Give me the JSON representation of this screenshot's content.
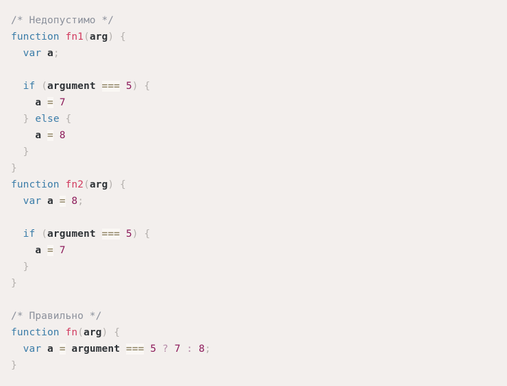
{
  "code_block": {
    "language": "javascript",
    "background_color": "#f3efed",
    "token_colors": {
      "comment": "#8b909b",
      "keyword": "#3a7ca8",
      "function_name": "#d13a5e",
      "identifier": "#2f3337",
      "number": "#8c1a5a",
      "operator": "#9a8f72",
      "operator_background": "#faf7f4",
      "ternary": "#b58aa8",
      "punctuation": "#b4b0ad"
    },
    "plain_text": "/* Недопустимо */\nfunction fn1(arg) {\n  var a;\n\n  if (argument === 5) {\n    a = 7\n  } else {\n    a = 8\n  }\n}\nfunction fn2(arg) {\n  var a = 8;\n\n  if (argument === 5) {\n    a = 7\n  }\n}\n\n/* Правильно */\nfunction fn(arg) {\n  var a = argument === 5 ? 7 : 8;\n}",
    "lines": [
      {
        "id": "line-1",
        "tokens": [
          {
            "t": "/* Недопустимо */",
            "c": "comment"
          }
        ]
      },
      {
        "id": "line-2",
        "tokens": [
          {
            "t": "function",
            "c": "keyword"
          },
          {
            "t": " ",
            "c": "plain"
          },
          {
            "t": "fn1",
            "c": "fnname"
          },
          {
            "t": "(",
            "c": "punct"
          },
          {
            "t": "arg",
            "c": "ident"
          },
          {
            "t": ")",
            "c": "punct"
          },
          {
            "t": " ",
            "c": "plain"
          },
          {
            "t": "{",
            "c": "punct"
          }
        ]
      },
      {
        "id": "line-3",
        "tokens": [
          {
            "t": "  ",
            "c": "plain"
          },
          {
            "t": "var",
            "c": "keyword"
          },
          {
            "t": " ",
            "c": "plain"
          },
          {
            "t": "a",
            "c": "ident"
          },
          {
            "t": ";",
            "c": "punct"
          }
        ]
      },
      {
        "id": "line-4",
        "tokens": []
      },
      {
        "id": "line-5",
        "tokens": [
          {
            "t": "  ",
            "c": "plain"
          },
          {
            "t": "if",
            "c": "keyword"
          },
          {
            "t": " ",
            "c": "plain"
          },
          {
            "t": "(",
            "c": "punct"
          },
          {
            "t": "argument",
            "c": "ident"
          },
          {
            "t": " ",
            "c": "plain"
          },
          {
            "t": "===",
            "c": "operator"
          },
          {
            "t": " ",
            "c": "plain"
          },
          {
            "t": "5",
            "c": "number"
          },
          {
            "t": ")",
            "c": "punct"
          },
          {
            "t": " ",
            "c": "plain"
          },
          {
            "t": "{",
            "c": "punct"
          }
        ]
      },
      {
        "id": "line-6",
        "tokens": [
          {
            "t": "    ",
            "c": "plain"
          },
          {
            "t": "a",
            "c": "ident"
          },
          {
            "t": " ",
            "c": "plain"
          },
          {
            "t": "=",
            "c": "operator"
          },
          {
            "t": " ",
            "c": "plain"
          },
          {
            "t": "7",
            "c": "number"
          }
        ]
      },
      {
        "id": "line-7",
        "tokens": [
          {
            "t": "  ",
            "c": "plain"
          },
          {
            "t": "}",
            "c": "punct"
          },
          {
            "t": " ",
            "c": "plain"
          },
          {
            "t": "else",
            "c": "keyword"
          },
          {
            "t": " ",
            "c": "plain"
          },
          {
            "t": "{",
            "c": "punct"
          }
        ]
      },
      {
        "id": "line-8",
        "tokens": [
          {
            "t": "    ",
            "c": "plain"
          },
          {
            "t": "a",
            "c": "ident"
          },
          {
            "t": " ",
            "c": "plain"
          },
          {
            "t": "=",
            "c": "operator"
          },
          {
            "t": " ",
            "c": "plain"
          },
          {
            "t": "8",
            "c": "number"
          }
        ]
      },
      {
        "id": "line-9",
        "tokens": [
          {
            "t": "  ",
            "c": "plain"
          },
          {
            "t": "}",
            "c": "punct"
          }
        ]
      },
      {
        "id": "line-10",
        "tokens": [
          {
            "t": "}",
            "c": "punct"
          }
        ]
      },
      {
        "id": "line-11",
        "tokens": [
          {
            "t": "function",
            "c": "keyword"
          },
          {
            "t": " ",
            "c": "plain"
          },
          {
            "t": "fn2",
            "c": "fnname"
          },
          {
            "t": "(",
            "c": "punct"
          },
          {
            "t": "arg",
            "c": "ident"
          },
          {
            "t": ")",
            "c": "punct"
          },
          {
            "t": " ",
            "c": "plain"
          },
          {
            "t": "{",
            "c": "punct"
          }
        ]
      },
      {
        "id": "line-12",
        "tokens": [
          {
            "t": "  ",
            "c": "plain"
          },
          {
            "t": "var",
            "c": "keyword"
          },
          {
            "t": " ",
            "c": "plain"
          },
          {
            "t": "a",
            "c": "ident"
          },
          {
            "t": " ",
            "c": "plain"
          },
          {
            "t": "=",
            "c": "operator"
          },
          {
            "t": " ",
            "c": "plain"
          },
          {
            "t": "8",
            "c": "number"
          },
          {
            "t": ";",
            "c": "punct"
          }
        ]
      },
      {
        "id": "line-13",
        "tokens": []
      },
      {
        "id": "line-14",
        "tokens": [
          {
            "t": "  ",
            "c": "plain"
          },
          {
            "t": "if",
            "c": "keyword"
          },
          {
            "t": " ",
            "c": "plain"
          },
          {
            "t": "(",
            "c": "punct"
          },
          {
            "t": "argument",
            "c": "ident"
          },
          {
            "t": " ",
            "c": "plain"
          },
          {
            "t": "===",
            "c": "operator"
          },
          {
            "t": " ",
            "c": "plain"
          },
          {
            "t": "5",
            "c": "number"
          },
          {
            "t": ")",
            "c": "punct"
          },
          {
            "t": " ",
            "c": "plain"
          },
          {
            "t": "{",
            "c": "punct"
          }
        ]
      },
      {
        "id": "line-15",
        "tokens": [
          {
            "t": "    ",
            "c": "plain"
          },
          {
            "t": "a",
            "c": "ident"
          },
          {
            "t": " ",
            "c": "plain"
          },
          {
            "t": "=",
            "c": "operator"
          },
          {
            "t": " ",
            "c": "plain"
          },
          {
            "t": "7",
            "c": "number"
          }
        ]
      },
      {
        "id": "line-16",
        "tokens": [
          {
            "t": "  ",
            "c": "plain"
          },
          {
            "t": "}",
            "c": "punct"
          }
        ]
      },
      {
        "id": "line-17",
        "tokens": [
          {
            "t": "}",
            "c": "punct"
          }
        ]
      },
      {
        "id": "line-18",
        "tokens": []
      },
      {
        "id": "line-19",
        "tokens": [
          {
            "t": "/* Правильно */",
            "c": "comment"
          }
        ]
      },
      {
        "id": "line-20",
        "tokens": [
          {
            "t": "function",
            "c": "keyword"
          },
          {
            "t": " ",
            "c": "plain"
          },
          {
            "t": "fn",
            "c": "fnname"
          },
          {
            "t": "(",
            "c": "punct"
          },
          {
            "t": "arg",
            "c": "ident"
          },
          {
            "t": ")",
            "c": "punct"
          },
          {
            "t": " ",
            "c": "plain"
          },
          {
            "t": "{",
            "c": "punct"
          }
        ]
      },
      {
        "id": "line-21",
        "tokens": [
          {
            "t": "  ",
            "c": "plain"
          },
          {
            "t": "var",
            "c": "keyword"
          },
          {
            "t": " ",
            "c": "plain"
          },
          {
            "t": "a",
            "c": "ident"
          },
          {
            "t": " ",
            "c": "plain"
          },
          {
            "t": "=",
            "c": "operator"
          },
          {
            "t": " ",
            "c": "plain"
          },
          {
            "t": "argument",
            "c": "ident"
          },
          {
            "t": " ",
            "c": "plain"
          },
          {
            "t": "===",
            "c": "operator"
          },
          {
            "t": " ",
            "c": "plain"
          },
          {
            "t": "5",
            "c": "number"
          },
          {
            "t": " ",
            "c": "plain"
          },
          {
            "t": "?",
            "c": "ternary"
          },
          {
            "t": " ",
            "c": "plain"
          },
          {
            "t": "7",
            "c": "number"
          },
          {
            "t": " ",
            "c": "plain"
          },
          {
            "t": ":",
            "c": "ternary"
          },
          {
            "t": " ",
            "c": "plain"
          },
          {
            "t": "8",
            "c": "number"
          },
          {
            "t": ";",
            "c": "punct"
          }
        ]
      },
      {
        "id": "line-22",
        "tokens": [
          {
            "t": "}",
            "c": "punct"
          }
        ]
      }
    ]
  }
}
